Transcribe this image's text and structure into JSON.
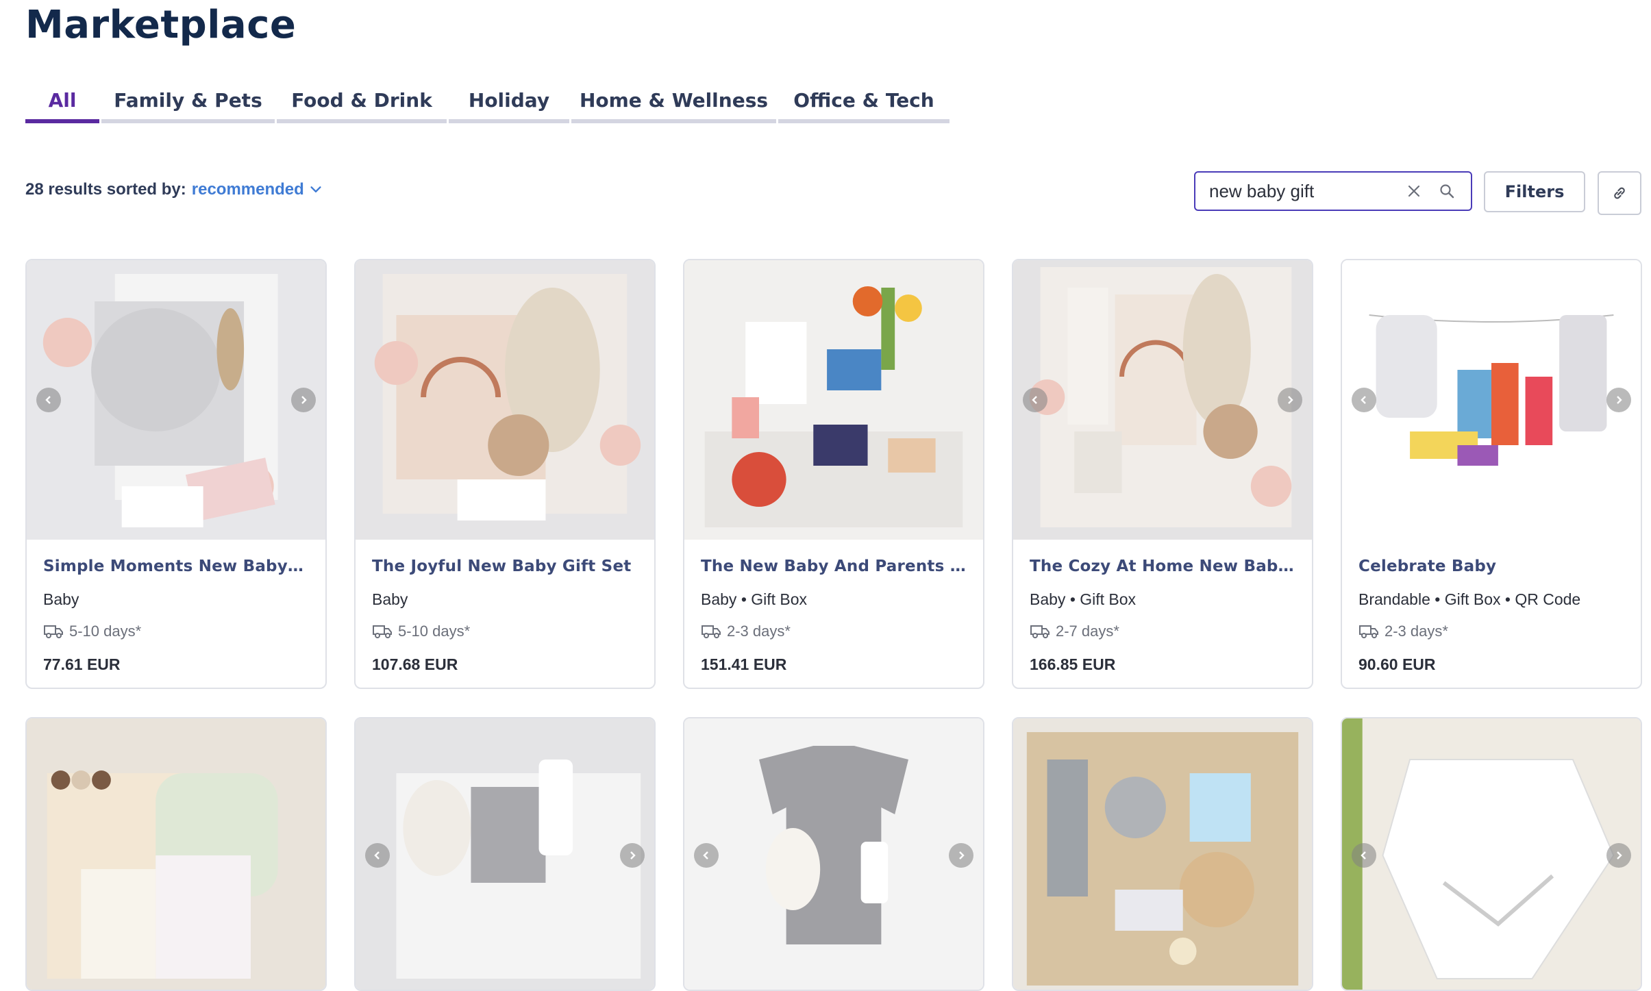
{
  "header": {
    "title": "Marketplace"
  },
  "tabs": [
    {
      "label": "All",
      "active": true
    },
    {
      "label": "Family & Pets",
      "active": false
    },
    {
      "label": "Food & Drink",
      "active": false
    },
    {
      "label": "Holiday",
      "active": false
    },
    {
      "label": "Home & Wellness",
      "active": false
    },
    {
      "label": "Office & Tech",
      "active": false
    }
  ],
  "toolbar": {
    "results_text": "28 results sorted by:",
    "sort_value": "recommended",
    "search_value": "new baby gift",
    "filters_label": "Filters"
  },
  "products": [
    {
      "title": "Simple Moments New Baby Gift ...",
      "tags": "Baby",
      "delivery": "5-10 days*",
      "price": "77.61 EUR"
    },
    {
      "title": "The Joyful New Baby Gift Set",
      "tags": "Baby",
      "delivery": "5-10 days*",
      "price": "107.68 EUR"
    },
    {
      "title": "The New Baby And Parents Gift ...",
      "tags": "Baby • Gift Box",
      "delivery": "2-3 days*",
      "price": "151.41 EUR"
    },
    {
      "title": "The Cozy At Home New Baby Gi...",
      "tags": "Baby • Gift Box",
      "delivery": "2-7 days*",
      "price": "166.85 EUR"
    },
    {
      "title": "Celebrate Baby",
      "tags": "Brandable • Gift Box • QR Code",
      "delivery": "2-3 days*",
      "price": "90.60 EUR"
    }
  ],
  "colors": {
    "title": "#13294b",
    "tab_active": "#5a2aa0",
    "link": "#3f7bd4",
    "search_border": "#4a3bb8"
  },
  "icons": [
    "chevron-down-icon",
    "clear-icon",
    "search-icon",
    "link-icon",
    "truck-icon",
    "arrow-left-icon",
    "arrow-right-icon"
  ]
}
